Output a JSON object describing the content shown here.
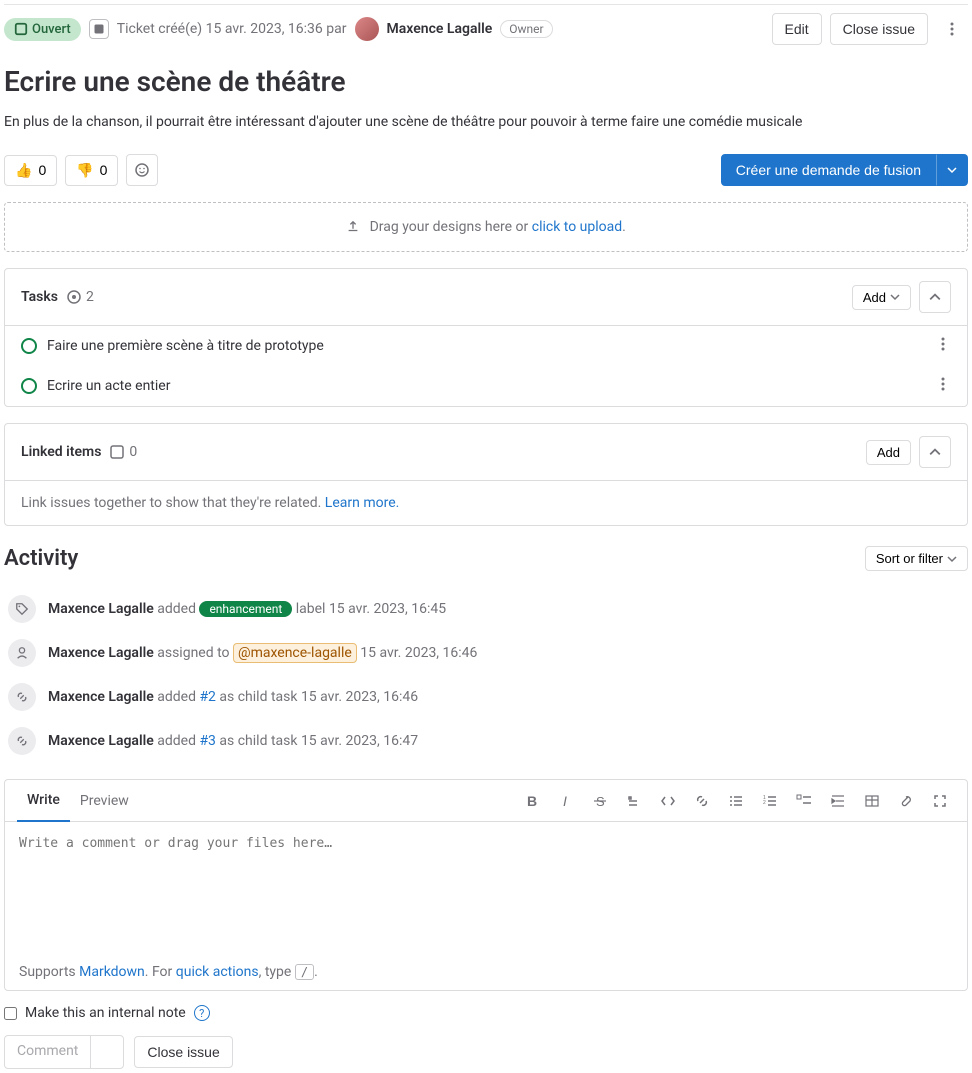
{
  "header": {
    "status": "Ouvert",
    "meta_prefix": "Ticket créé(e)",
    "created_at": "15 avr. 2023, 16:36",
    "by_word": "par",
    "author": "Maxence Lagalle",
    "owner_badge": "Owner",
    "edit": "Edit",
    "close_issue": "Close issue"
  },
  "issue": {
    "title": "Ecrire une scène de théâtre",
    "description": "En plus de la chanson, il pourrait être intéressant d'ajouter une scène de théâtre pour pouvoir à terme faire une comédie musicale"
  },
  "reactions": {
    "thumbs_up": "0",
    "thumbs_down": "0"
  },
  "merge_request_btn": "Créer une demande de fusion",
  "upload": {
    "text": "Drag your designs here or ",
    "link": "click to upload",
    "suffix": "."
  },
  "tasks": {
    "title": "Tasks",
    "count": "2",
    "add": "Add",
    "items": [
      {
        "title": "Faire une première scène à titre de prototype"
      },
      {
        "title": "Ecrire un acte entier"
      }
    ]
  },
  "linked": {
    "title": "Linked items",
    "count": "0",
    "add": "Add",
    "body_text": "Link issues together to show that they're related. ",
    "learn_more": "Learn more."
  },
  "activity": {
    "title": "Activity",
    "sort_filter": "Sort or filter",
    "items": [
      {
        "icon": "tag",
        "who": "Maxence Lagalle",
        "action_pre": " added ",
        "label": "enhancement",
        "action_post": " label ",
        "time": "15 avr. 2023, 16:45"
      },
      {
        "icon": "user",
        "who": "Maxence Lagalle",
        "action_pre": " assigned to ",
        "mention": "@maxence-lagalle",
        "action_post": " ",
        "time": "15 avr. 2023, 16:46"
      },
      {
        "icon": "link",
        "who": "Maxence Lagalle",
        "action_pre": " added ",
        "ref": "#2",
        "action_post": " as child task ",
        "time": "15 avr. 2023, 16:46"
      },
      {
        "icon": "link",
        "who": "Maxence Lagalle",
        "action_pre": " added ",
        "ref": "#3",
        "action_post": " as child task ",
        "time": "15 avr. 2023, 16:47"
      }
    ]
  },
  "editor": {
    "write_tab": "Write",
    "preview_tab": "Preview",
    "placeholder": "Write a comment or drag your files here…",
    "supports": "Supports ",
    "markdown": "Markdown",
    "for_text": ". For ",
    "quick_actions": "quick actions",
    "type_text": ", type ",
    "slash": "/",
    "period": "."
  },
  "internal_note": "Make this an internal note",
  "comment_btn": "Comment",
  "close_issue_btn": "Close issue"
}
